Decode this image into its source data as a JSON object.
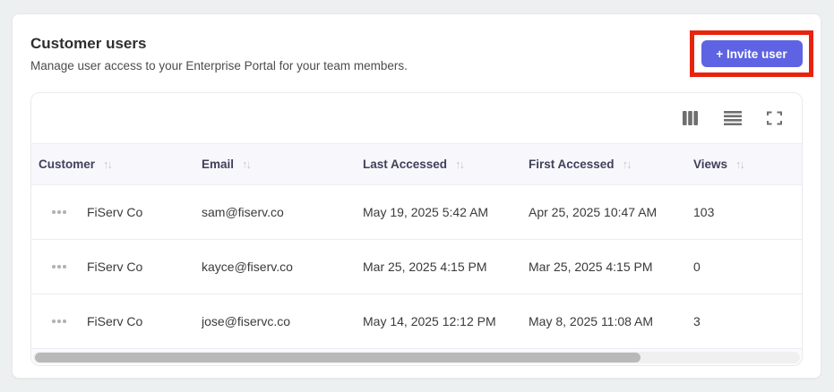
{
  "header": {
    "title": "Customer users",
    "subtitle": "Manage user access to your Enterprise Portal for your team members.",
    "invite_button_label": "+ Invite user"
  },
  "colors": {
    "accent": "#5e63e3",
    "annotation_highlight": "#e8230d",
    "table_header_bg": "#f8f8fc",
    "page_bg": "#edf0f0"
  },
  "icons": {
    "sort": "↑↓",
    "toolbar": [
      "columns-icon",
      "rows-density-icon",
      "fullscreen-icon"
    ],
    "row_menu": "ellipsis-icon"
  },
  "table": {
    "columns": [
      {
        "label": "Customer",
        "sortable": true
      },
      {
        "label": "Email",
        "sortable": true
      },
      {
        "label": "Last Accessed",
        "sortable": true
      },
      {
        "label": "First Accessed",
        "sortable": true
      },
      {
        "label": "Views",
        "sortable": true
      }
    ],
    "rows": [
      {
        "customer": "FiServ Co",
        "email": "sam@fiserv.co",
        "last_accessed": "May 19, 2025 5:42 AM",
        "first_accessed": "Apr 25, 2025 10:47 AM",
        "views": "103"
      },
      {
        "customer": "FiServ Co",
        "email": "kayce@fiserv.co",
        "last_accessed": "Mar 25, 2025 4:15 PM",
        "first_accessed": "Mar 25, 2025 4:15 PM",
        "views": "0"
      },
      {
        "customer": "FiServ Co",
        "email": "jose@fiservc.co",
        "last_accessed": "May 14, 2025 12:12 PM",
        "first_accessed": "May 8, 2025 11:08 AM",
        "views": "3"
      }
    ]
  }
}
